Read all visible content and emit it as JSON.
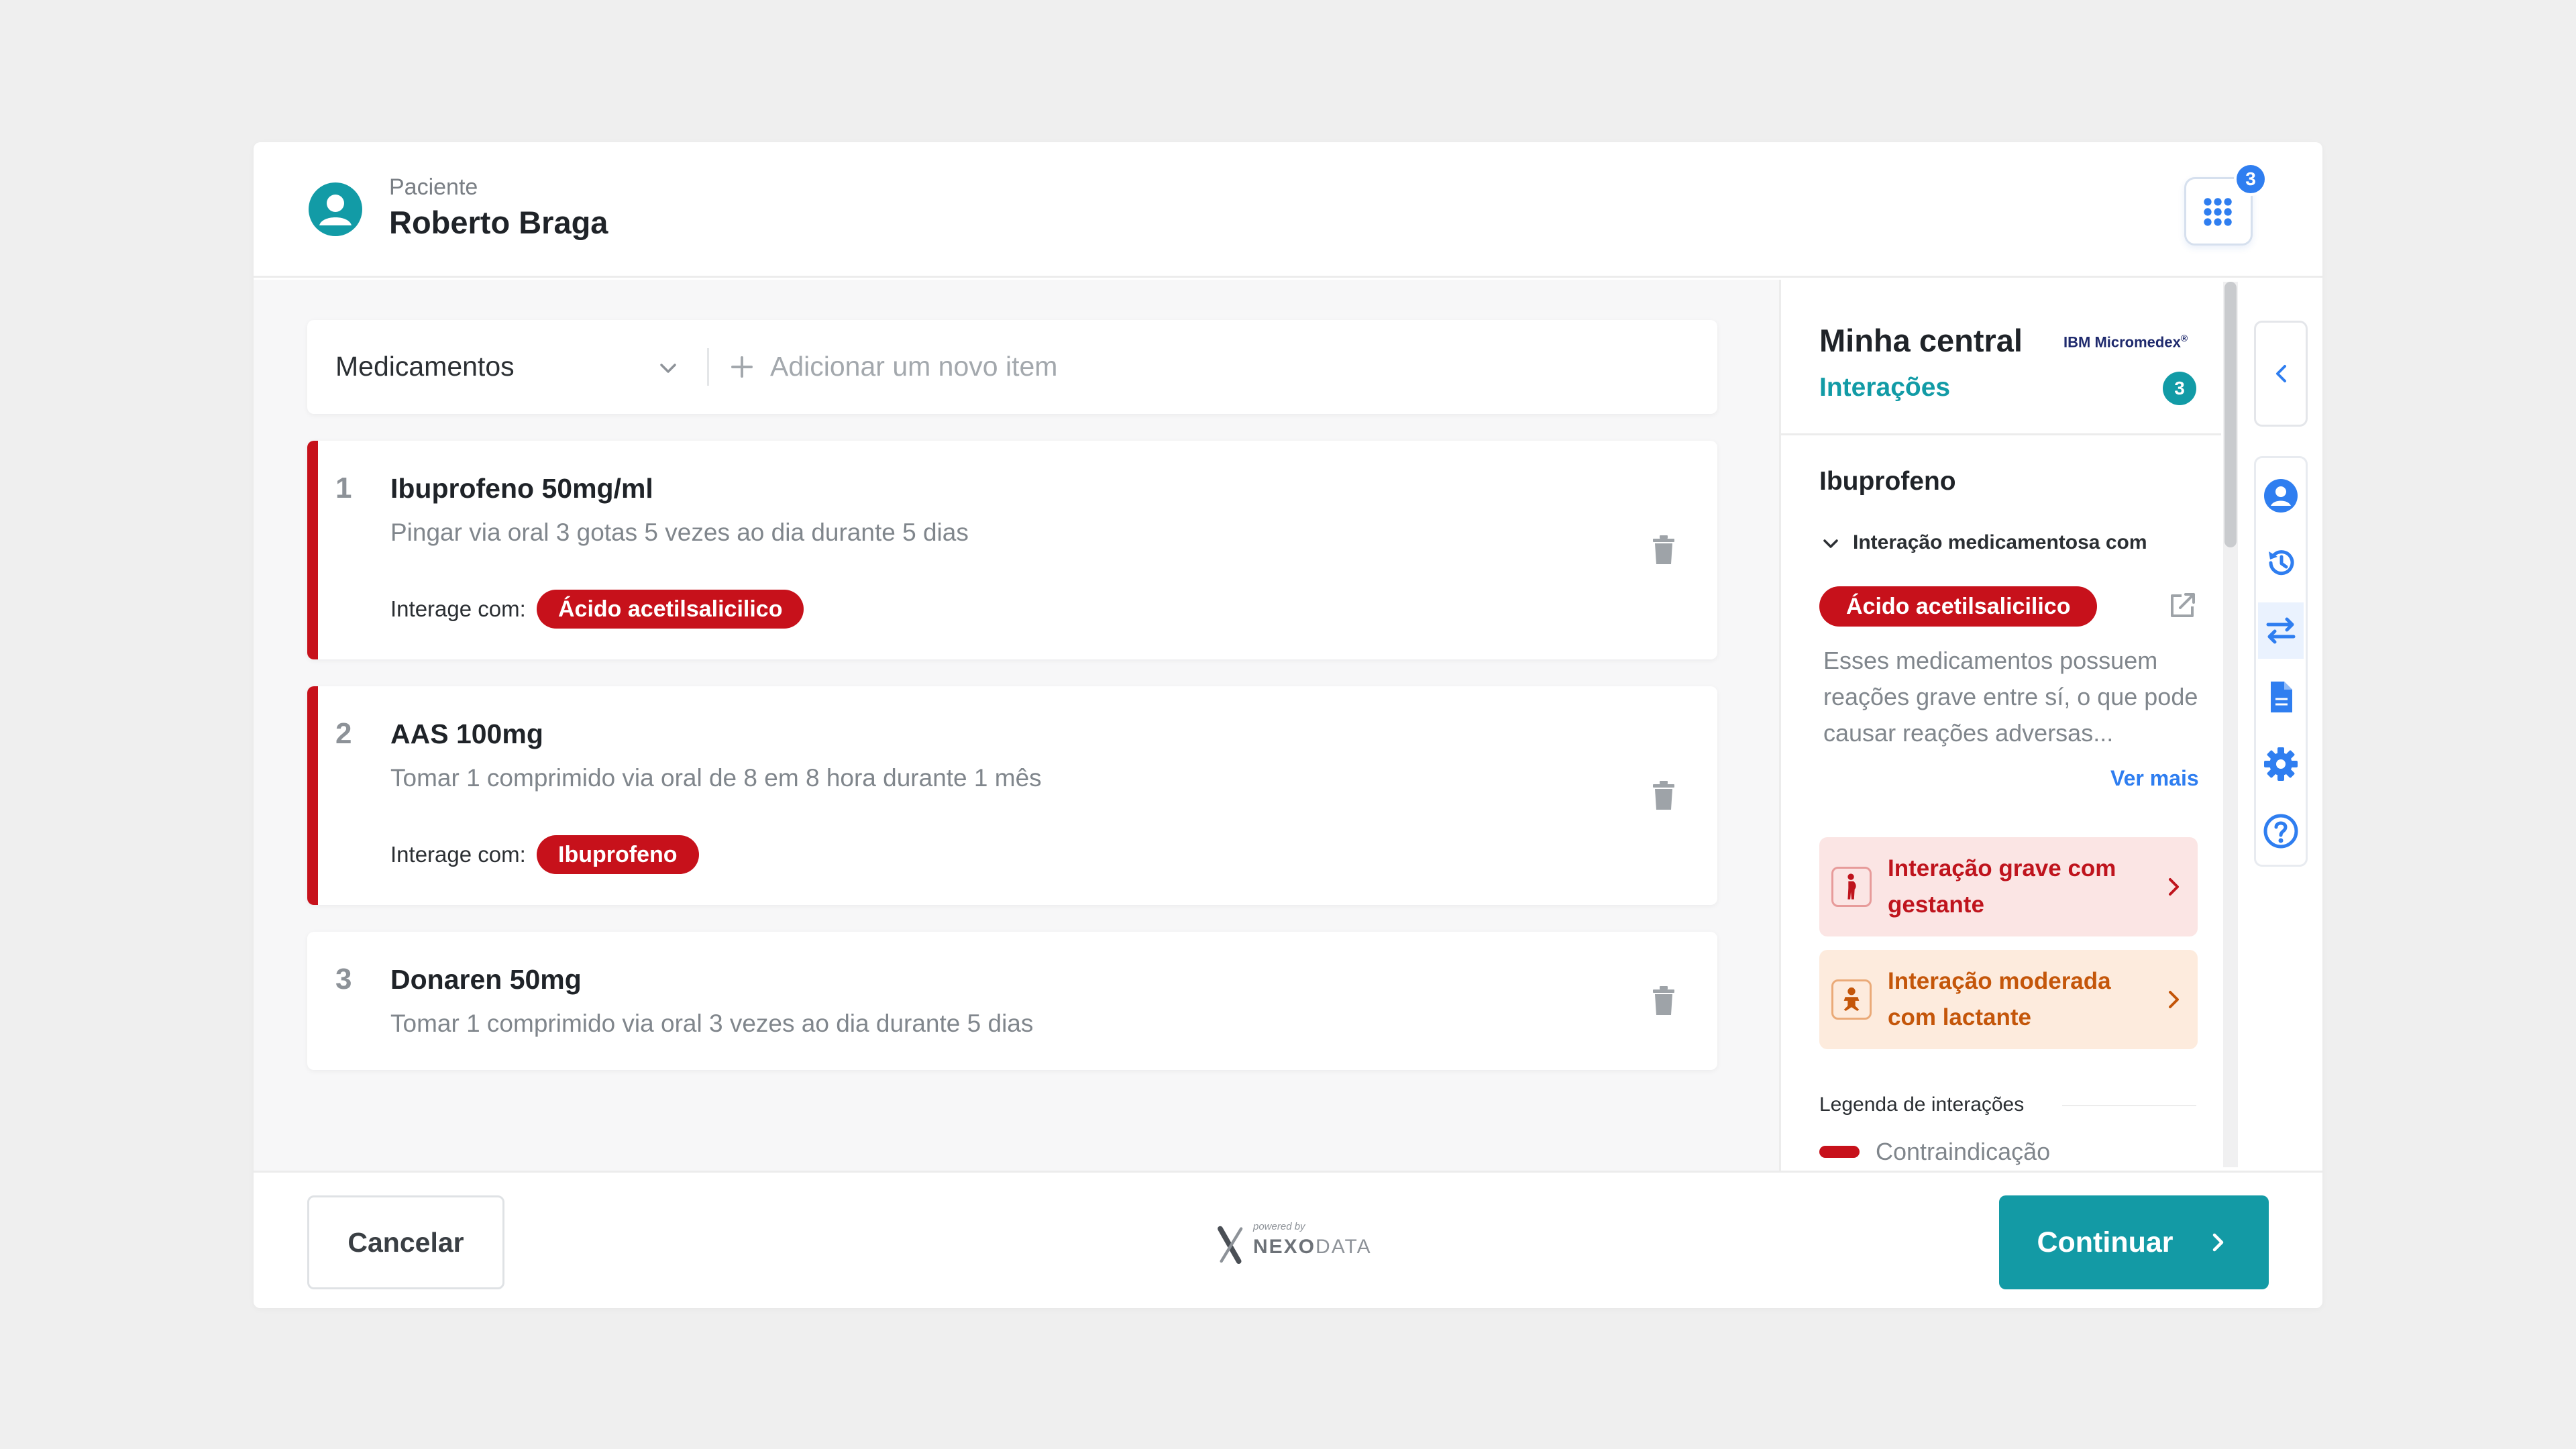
{
  "patient": {
    "label": "Paciente",
    "name": "Roberto Braga"
  },
  "apps": {
    "badge": "3"
  },
  "selector": {
    "category": "Medicamentos",
    "add_placeholder": "Adicionar um novo item"
  },
  "medications": [
    {
      "number": "1",
      "name": "Ibuprofeno 50mg/ml",
      "description": "Pingar via oral 3 gotas 5 vezes ao dia durante 5 dias",
      "interacts_label": "Interage com:",
      "interacts_with": "Ácido acetilsalicilico"
    },
    {
      "number": "2",
      "name": "AAS 100mg",
      "description": "Tomar 1 comprimido via oral de 8 em 8 hora durante 1 mês",
      "interacts_label": "Interage com:",
      "interacts_with": "Ibuprofeno"
    },
    {
      "number": "3",
      "name": "Donaren 50mg",
      "description": "Tomar 1 comprimido via oral 3 vezes ao dia durante 5 dias"
    }
  ],
  "panel": {
    "title": "Minha central",
    "brand": "IBM Micromedex",
    "brand_mark": "®",
    "tab": "Interações",
    "tab_count": "3",
    "drug": "Ibuprofeno",
    "interaction_heading": "Interação medicamentosa com",
    "interaction_drug": "Ácido acetilsalicilico",
    "interaction_text": "Esses medicamentos possuem reações grave entre sí, o que pode causar reações adversas...",
    "see_more": "Ver mais",
    "alerts": [
      {
        "text": "Interação grave com gestante",
        "severity": "grave",
        "icon": "pregnant-icon"
      },
      {
        "text": "Interação moderada com lactante",
        "severity": "moderada",
        "icon": "baby-icon"
      }
    ],
    "legend_title": "Legenda de interações",
    "legend_items": [
      {
        "label": "Contraindicação",
        "color": "#c7111b"
      }
    ]
  },
  "footer": {
    "cancel": "Cancelar",
    "continue": "Continuar",
    "logo_powered": "powered by",
    "logo_name_bold": "NEXO",
    "logo_name_light": "DATA"
  },
  "colors": {
    "accent": "#139aa5",
    "danger": "#c7111b",
    "link": "#2f7ef0",
    "warning": "#c4560a"
  }
}
